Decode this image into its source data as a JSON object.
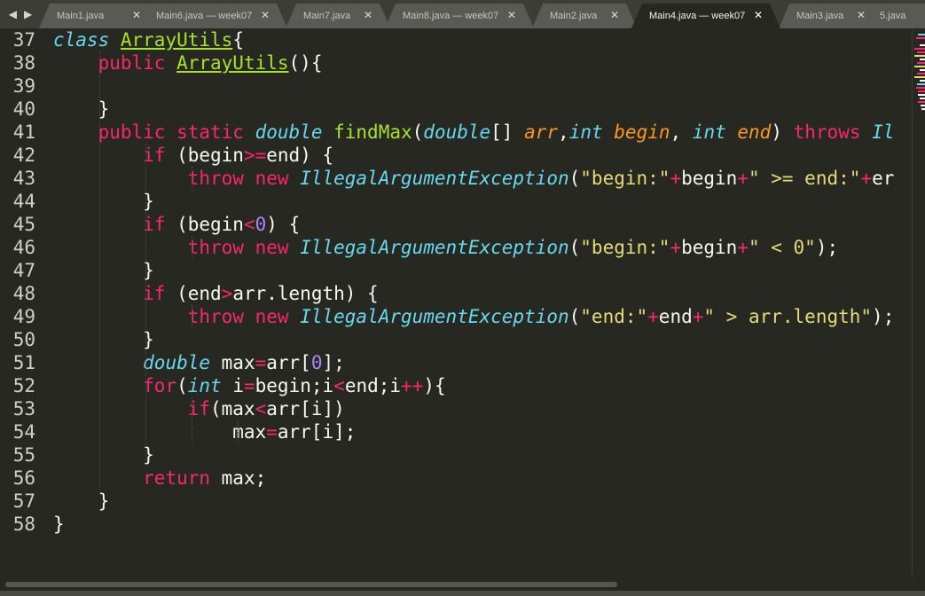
{
  "tabs": [
    {
      "label": "Main1.java",
      "active": false
    },
    {
      "label": "Main6.java — week07",
      "active": false
    },
    {
      "label": "Main7.java",
      "active": false
    },
    {
      "label": "Main8.java — week07",
      "active": false
    },
    {
      "label": "Main2.java",
      "active": false
    },
    {
      "label": "Main4.java — week07",
      "active": true
    },
    {
      "label": "Main3.java",
      "active": false
    },
    {
      "label": "5.java",
      "active": false
    }
  ],
  "tab_close_glyph": "✕",
  "nav": {
    "back": "◀",
    "forward": "▶"
  },
  "editor": {
    "line_numbers": [
      "37",
      "38",
      "39",
      "40",
      "41",
      "42",
      "43",
      "44",
      "45",
      "46",
      "47",
      "48",
      "49",
      "50",
      "51",
      "52",
      "53",
      "54",
      "55",
      "56",
      "57",
      "58"
    ],
    "lines": [
      [
        [
          "typ",
          "class"
        ],
        [
          "pl",
          " "
        ],
        [
          "clsdef",
          "ArrayUtils"
        ],
        [
          "pl",
          "{"
        ]
      ],
      [
        [
          "pl",
          "    "
        ],
        [
          "kw",
          "public"
        ],
        [
          "pl",
          " "
        ],
        [
          "clsdef",
          "ArrayUtils"
        ],
        [
          "pl",
          "(){"
        ]
      ],
      [],
      [
        [
          "pl",
          "    }"
        ]
      ],
      [
        [
          "pl",
          "    "
        ],
        [
          "kw",
          "public"
        ],
        [
          "pl",
          " "
        ],
        [
          "kw",
          "static"
        ],
        [
          "pl",
          " "
        ],
        [
          "typ",
          "double"
        ],
        [
          "pl",
          " "
        ],
        [
          "ent",
          "findMax"
        ],
        [
          "pl",
          "("
        ],
        [
          "typ",
          "double"
        ],
        [
          "pl",
          "[] "
        ],
        [
          "prm",
          "arr"
        ],
        [
          "pl",
          ","
        ],
        [
          "typ",
          "int"
        ],
        [
          "pl",
          " "
        ],
        [
          "prm",
          "begin"
        ],
        [
          "pl",
          ", "
        ],
        [
          "typ",
          "int"
        ],
        [
          "pl",
          " "
        ],
        [
          "prm",
          "end"
        ],
        [
          "pl",
          ") "
        ],
        [
          "kw",
          "throws"
        ],
        [
          "pl",
          " "
        ],
        [
          "typ",
          "Il"
        ]
      ],
      [
        [
          "pl",
          "        "
        ],
        [
          "kw",
          "if"
        ],
        [
          "pl",
          " (begin"
        ],
        [
          "op",
          ">="
        ],
        [
          "pl",
          "end) {"
        ]
      ],
      [
        [
          "pl",
          "            "
        ],
        [
          "kw",
          "throw"
        ],
        [
          "pl",
          " "
        ],
        [
          "kw",
          "new"
        ],
        [
          "pl",
          " "
        ],
        [
          "typ",
          "IllegalArgumentException"
        ],
        [
          "pl",
          "("
        ],
        [
          "str",
          "\"begin:\""
        ],
        [
          "op",
          "+"
        ],
        [
          "pl",
          "begin"
        ],
        [
          "op",
          "+"
        ],
        [
          "str",
          "\" >= end:\""
        ],
        [
          "op",
          "+"
        ],
        [
          "pl",
          "er"
        ]
      ],
      [
        [
          "pl",
          "        }"
        ]
      ],
      [
        [
          "pl",
          "        "
        ],
        [
          "kw",
          "if"
        ],
        [
          "pl",
          " (begin"
        ],
        [
          "op",
          "<"
        ],
        [
          "num",
          "0"
        ],
        [
          "pl",
          ") {"
        ]
      ],
      [
        [
          "pl",
          "            "
        ],
        [
          "kw",
          "throw"
        ],
        [
          "pl",
          " "
        ],
        [
          "kw",
          "new"
        ],
        [
          "pl",
          " "
        ],
        [
          "typ",
          "IllegalArgumentException"
        ],
        [
          "pl",
          "("
        ],
        [
          "str",
          "\"begin:\""
        ],
        [
          "op",
          "+"
        ],
        [
          "pl",
          "begin"
        ],
        [
          "op",
          "+"
        ],
        [
          "str",
          "\" < 0\""
        ],
        [
          "pl",
          ");"
        ]
      ],
      [
        [
          "pl",
          "        }"
        ]
      ],
      [
        [
          "pl",
          "        "
        ],
        [
          "kw",
          "if"
        ],
        [
          "pl",
          " (end"
        ],
        [
          "op",
          ">"
        ],
        [
          "pl",
          "arr.length) {"
        ]
      ],
      [
        [
          "pl",
          "            "
        ],
        [
          "kw",
          "throw"
        ],
        [
          "pl",
          " "
        ],
        [
          "kw",
          "new"
        ],
        [
          "pl",
          " "
        ],
        [
          "typ",
          "IllegalArgumentException"
        ],
        [
          "pl",
          "("
        ],
        [
          "str",
          "\"end:\""
        ],
        [
          "op",
          "+"
        ],
        [
          "pl",
          "end"
        ],
        [
          "op",
          "+"
        ],
        [
          "str",
          "\" > arr.length\""
        ],
        [
          "pl",
          ");"
        ]
      ],
      [
        [
          "pl",
          "        }"
        ]
      ],
      [
        [
          "pl",
          "        "
        ],
        [
          "typ",
          "double"
        ],
        [
          "pl",
          " max"
        ],
        [
          "op",
          "="
        ],
        [
          "pl",
          "arr["
        ],
        [
          "num",
          "0"
        ],
        [
          "pl",
          "];"
        ]
      ],
      [
        [
          "pl",
          "        "
        ],
        [
          "kw",
          "for"
        ],
        [
          "pl",
          "("
        ],
        [
          "typ",
          "int"
        ],
        [
          "pl",
          " i"
        ],
        [
          "op",
          "="
        ],
        [
          "pl",
          "begin;i"
        ],
        [
          "op",
          "<"
        ],
        [
          "pl",
          "end;i"
        ],
        [
          "op",
          "++"
        ],
        [
          "pl",
          "){"
        ]
      ],
      [
        [
          "pl",
          "            "
        ],
        [
          "kw",
          "if"
        ],
        [
          "pl",
          "(max"
        ],
        [
          "op",
          "<"
        ],
        [
          "pl",
          "arr[i])"
        ]
      ],
      [
        [
          "pl",
          "                max"
        ],
        [
          "op",
          "="
        ],
        [
          "pl",
          "arr[i];"
        ]
      ],
      [
        [
          "pl",
          "        }"
        ]
      ],
      [
        [
          "pl",
          "        "
        ],
        [
          "kw",
          "return"
        ],
        [
          "pl",
          " max;"
        ]
      ],
      [
        [
          "pl",
          "    }"
        ]
      ],
      [
        [
          "pl",
          "}"
        ]
      ]
    ]
  },
  "colors": {
    "background": "#272822",
    "keyword": "#f92672",
    "type": "#66d9ef",
    "entity": "#a6e22e",
    "parameter": "#fd971f",
    "string": "#e6db74",
    "number": "#ae81ff",
    "text": "#f8f8f2"
  }
}
